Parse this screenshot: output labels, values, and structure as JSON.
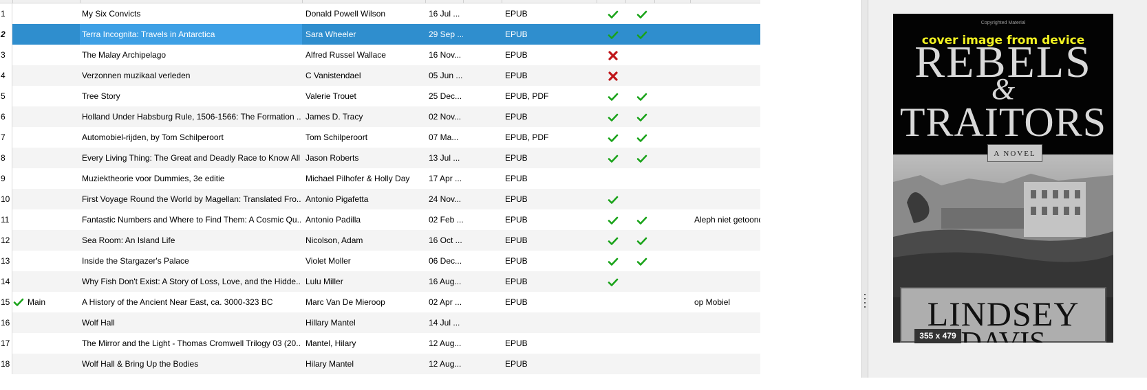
{
  "rows": [
    {
      "num": "1",
      "library": "",
      "title": "My Six Convicts",
      "author": "Donald Powell Wilson",
      "date": "16 Jul ...",
      "formats": "EPUB",
      "col1": "check",
      "col2": "check",
      "note": ""
    },
    {
      "num": "2",
      "library": "",
      "title": "Terra Incognita: Travels in Antarctica",
      "author": "Sara Wheeler",
      "date": "29 Sep ...",
      "formats": "EPUB",
      "col1": "check",
      "col2": "check",
      "note": "",
      "selected": true
    },
    {
      "num": "3",
      "library": "",
      "title": "The Malay Archipelago",
      "author": "Alfred Russel Wallace",
      "date": "16 Nov...",
      "formats": "EPUB",
      "col1": "cross",
      "col2": "",
      "note": ""
    },
    {
      "num": "4",
      "library": "",
      "title": "Verzonnen muzikaal verleden",
      "author": "C Vanistendael",
      "date": "05 Jun ...",
      "formats": "EPUB",
      "col1": "cross",
      "col2": "",
      "note": ""
    },
    {
      "num": "5",
      "library": "",
      "title": "Tree Story",
      "author": "Valerie Trouet",
      "date": "25 Dec...",
      "formats": "EPUB, PDF",
      "col1": "check",
      "col2": "check",
      "note": ""
    },
    {
      "num": "6",
      "library": "",
      "title": "Holland Under Habsburg Rule, 1506-1566: The Formation ...",
      "author": "James D. Tracy",
      "date": "02 Nov...",
      "formats": "EPUB",
      "col1": "check",
      "col2": "check",
      "note": ""
    },
    {
      "num": "7",
      "library": "",
      "title": "Automobiel-rijden, by Tom Schilperoort",
      "author": "Tom Schilperoort",
      "date": "07 Ma...",
      "formats": "EPUB, PDF",
      "col1": "check",
      "col2": "check",
      "note": ""
    },
    {
      "num": "8",
      "library": "",
      "title": "Every Living Thing: The Great and Deadly Race to Know All ...",
      "author": "Jason Roberts",
      "date": "13 Jul ...",
      "formats": "EPUB",
      "col1": "check",
      "col2": "check",
      "note": ""
    },
    {
      "num": "9",
      "library": "",
      "title": "Muziektheorie voor Dummies, 3e editie",
      "author": "Michael Pilhofer & Holly Day",
      "date": "17 Apr ...",
      "formats": "EPUB",
      "col1": "",
      "col2": "",
      "note": ""
    },
    {
      "num": "10",
      "library": "",
      "title": "First Voyage Round the World by Magellan: Translated Fro...",
      "author": "Antonio Pigafetta",
      "date": "24 Nov...",
      "formats": "EPUB",
      "col1": "check",
      "col2": "",
      "note": ""
    },
    {
      "num": "11",
      "library": "",
      "title": "Fantastic Numbers and Where to Find Them: A Cosmic Qu...",
      "author": "Antonio Padilla",
      "date": "02 Feb ...",
      "formats": "EPUB",
      "col1": "check",
      "col2": "check",
      "note": "Aleph niet getoond"
    },
    {
      "num": "12",
      "library": "",
      "title": "Sea Room: An Island Life",
      "author": "Nicolson, Adam",
      "date": "16 Oct ...",
      "formats": "EPUB",
      "col1": "check",
      "col2": "check",
      "note": ""
    },
    {
      "num": "13",
      "library": "",
      "title": "Inside the Stargazer's Palace",
      "author": "Violet Moller",
      "date": "06 Dec...",
      "formats": "EPUB",
      "col1": "check",
      "col2": "check",
      "note": ""
    },
    {
      "num": "14",
      "library": "",
      "title": "Why Fish Don't Exist: A Story of Loss, Love, and the Hidde...",
      "author": "Lulu Miller",
      "date": "16 Aug...",
      "formats": "EPUB",
      "col1": "check",
      "col2": "",
      "note": ""
    },
    {
      "num": "15",
      "library": "Main",
      "title": "A History of the Ancient Near East, ca. 3000-323 BC",
      "author": "Marc Van De Mieroop",
      "date": "02 Apr ...",
      "formats": "EPUB",
      "col1": "",
      "col2": "",
      "note": "op Mobiel"
    },
    {
      "num": "16",
      "library": "",
      "title": "Wolf Hall",
      "author": "Hillary Mantel",
      "date": "14 Jul ...",
      "formats": "",
      "col1": "",
      "col2": "",
      "note": ""
    },
    {
      "num": "17",
      "library": "",
      "title": "The Mirror and the Light - Thomas Cromwell Trilogy 03 (20...",
      "author": "Mantel, Hilary",
      "date": "12 Aug...",
      "formats": "EPUB",
      "col1": "",
      "col2": "",
      "note": ""
    },
    {
      "num": "18",
      "library": "",
      "title": "Wolf Hall & Bring Up the Bodies",
      "author": "Hilary Mantel",
      "date": "12 Aug...",
      "formats": "EPUB",
      "col1": "",
      "col2": "",
      "note": ""
    }
  ],
  "cover": {
    "overlay": "cover image from device",
    "size": "355 x 479",
    "small_top": "Copyrighted Material",
    "title_line1": "REBELS",
    "amp": "&",
    "title_line2": "TRAITORS",
    "subtitle": "A NOVEL",
    "author_line1": "LINDSEY",
    "author_line2": "DAVIS"
  },
  "colors": {
    "check": "#1aa31a",
    "cross": "#c0161a",
    "selected_row": "#2f8ece",
    "selected_cell": "#3ea0e5",
    "overlay_text": "#f4f421"
  }
}
